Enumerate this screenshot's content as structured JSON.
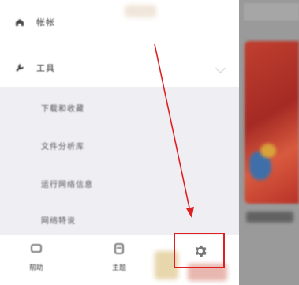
{
  "drawer": {
    "top_item": {
      "label": "帐帐",
      "icon": "home-icon"
    },
    "tools": {
      "label": "工具",
      "icon": "tools-icon"
    },
    "submenu": [
      {
        "label": "下载和收藏"
      },
      {
        "label": "文件分析库"
      },
      {
        "label": "运行网络信息"
      },
      {
        "label": "网络特说"
      }
    ]
  },
  "bottom_bar": {
    "items": [
      {
        "label": "帮助",
        "icon": "help-icon"
      },
      {
        "label": "主题",
        "icon": "theme-icon"
      }
    ],
    "settings_icon": "gear-icon"
  },
  "annotation": {
    "arrow_color": "#e02020",
    "highlight_color": "#e02020"
  }
}
